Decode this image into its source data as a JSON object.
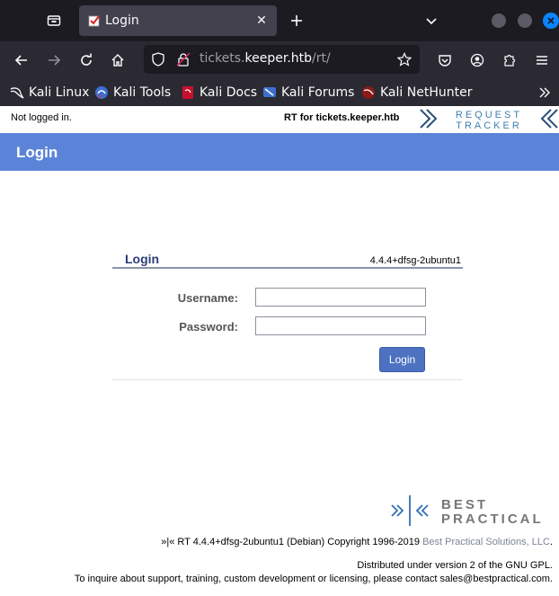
{
  "browser": {
    "tab": {
      "title": "Login"
    },
    "url": {
      "prefix": "tickets.",
      "host": "keeper.htb",
      "path": "/rt/"
    },
    "bookmarks": [
      {
        "label": "Kali Linux",
        "icon": "kali-dragon-icon"
      },
      {
        "label": "Kali Tools",
        "icon": "kali-tools-icon"
      },
      {
        "label": "Kali Docs",
        "icon": "kali-docs-icon"
      },
      {
        "label": "Kali Forums",
        "icon": "kali-forums-icon"
      },
      {
        "label": "Kali NetHunter",
        "icon": "kali-nethunter-icon"
      }
    ]
  },
  "rt": {
    "status": {
      "not_logged_in": "Not logged in.",
      "rt_for": "RT for tickets.keeper.htb"
    },
    "logo": {
      "line1": "REQUEST",
      "line2": "TRACKER"
    },
    "header": {
      "title": "Login"
    },
    "login": {
      "title": "Login",
      "version": "4.4.4+dfsg-2ubuntu1",
      "username_label": "Username:",
      "password_label": "Password:",
      "username_value": "",
      "password_value": "",
      "button": "Login"
    },
    "footer": {
      "bp_logo_line1": "BEST",
      "bp_logo_line2": "PRACTICAL",
      "copyright": "»|« RT 4.4.4+dfsg-2ubuntu1 (Debian) Copyright 1996-2019 ",
      "company_link": "Best Practical Solutions, LLC",
      "copyright_end": ".",
      "license": "Distributed under version 2 of the GNU GPL.",
      "contact": "To inquire about support, training, custom development or licensing, please contact sales@bestpractical.com."
    }
  },
  "colors": {
    "header_blue": "#5b84d8",
    "button_blue": "#4e72c2",
    "title_navy": "#2b3d7a",
    "browser_dark": "#1c1b22"
  }
}
